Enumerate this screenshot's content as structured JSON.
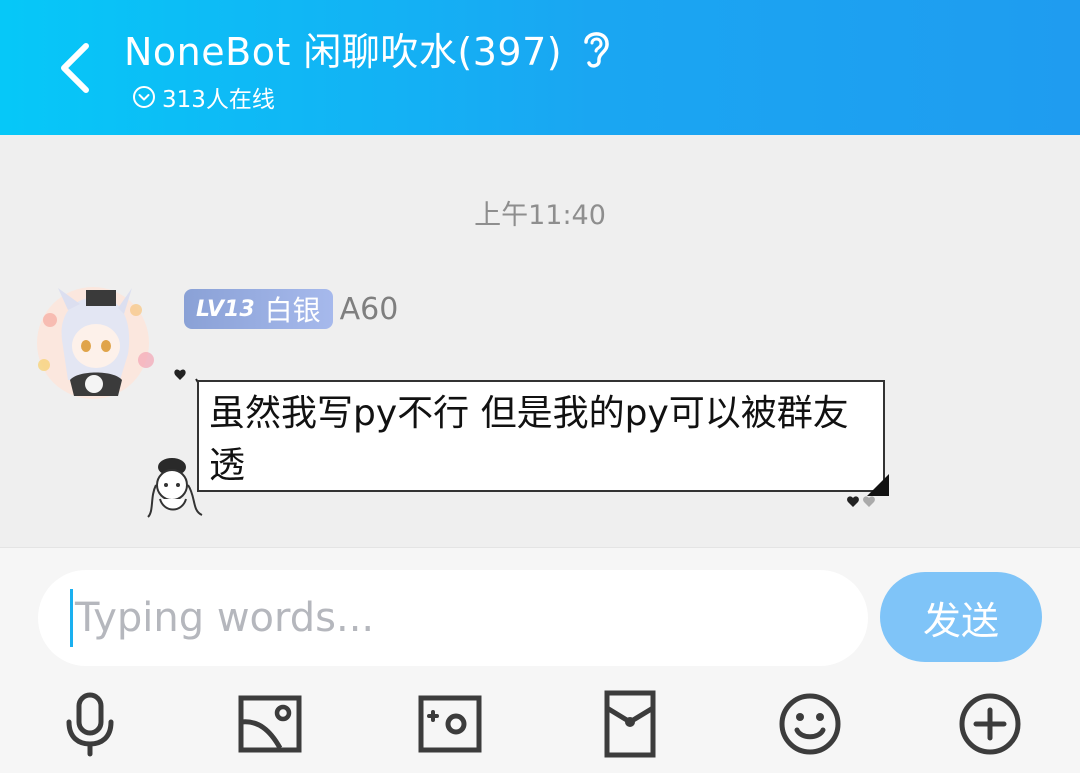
{
  "header": {
    "title": "NoneBot 闲聊吹水(397)",
    "online": "313人在线",
    "back_icon": "chevron-left-icon",
    "ear_icon": "ear-icon"
  },
  "chat": {
    "timestamp": "上午11:40",
    "message": {
      "level": "LV13",
      "rank": "白银",
      "sender": "A60",
      "text": "虽然我写py不行 但是我的py可以被群友透"
    }
  },
  "composer": {
    "placeholder": "Typing words...",
    "send_label": "发送"
  },
  "toolbar": {
    "items": [
      "microphone-icon",
      "image-icon",
      "camera-icon",
      "red-packet-icon",
      "emoji-icon",
      "plus-icon"
    ]
  },
  "colors": {
    "header_start": "#06c8f8",
    "header_end": "#1f9cf0",
    "send_button": "#7fc4f8",
    "badge": "#8aa1d6"
  }
}
